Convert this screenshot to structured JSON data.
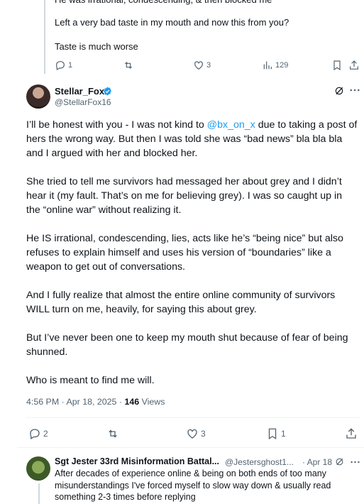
{
  "previous_post": {
    "line1": "He was irrational, condescending, & then blocked me",
    "line2": "Left a very bad taste in my mouth and now this from you?",
    "line3": "Taste is much worse",
    "replies": "1",
    "reposts": "",
    "likes": "3",
    "views": "129"
  },
  "main_post": {
    "name": "Stellar_Fox",
    "handle": "@StellarFox16",
    "p1_before": "I’ll be honest with you - I was not kind to ",
    "mention": "@bx_on_x",
    "p1_after": " due to taking a post of hers the wrong way. But then I was told she was “bad news” bla bla bla and I argued with her and blocked her.",
    "p2": "She tried to tell me survivors had messaged her about grey and I didn’t hear it (my fault. That’s on me for believing grey). I was so caught up in the “online war” without realizing it.",
    "p3": "He IS irrational, condescending, lies, acts like he’s “being nice” but also refuses to explain himself and uses his version of “boundaries” like a weapon to get out of conversations.",
    "p4": "And I fully realize that almost the entire online community of survivors WILL turn on me, heavily, for saying this about grey.",
    "p5": "But I’ve never been one to keep my mouth shut because of fear of being shunned.",
    "p6": "Who is meant to find me will.",
    "timestamp": "4:56 PM · Apr 18, 2025 · ",
    "views_count": "146",
    "views_label": " Views",
    "replies": "2",
    "likes": "3",
    "bookmarks": "1"
  },
  "reply_post": {
    "name": "Sgt Jester 33rd Misinformation Battal...",
    "handle": "@Jestersghost1...",
    "date": "· Apr 18",
    "text": "After decades of experience online & being on both ends of too many misunderstandings I've forced myself to slow way down & usually read something 2-3 times before replying"
  },
  "colors": {
    "accent": "#1d9bf0",
    "text": "#0f1419",
    "muted": "#536471",
    "border": "#eff3f4"
  }
}
